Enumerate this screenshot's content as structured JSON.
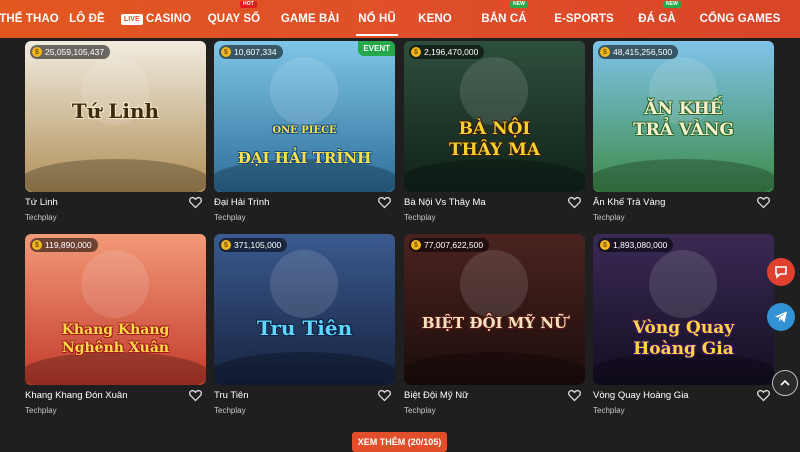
{
  "nav": {
    "items": [
      {
        "label": "THỂ THAO"
      },
      {
        "label": "LÔ ĐỀ"
      },
      {
        "label": "CASINO",
        "live": "LIVE"
      },
      {
        "label": "QUAY SỐ",
        "tag": "HOT"
      },
      {
        "label": "GAME BÀI"
      },
      {
        "label": "NỔ HŨ",
        "active": true
      },
      {
        "label": "KENO"
      },
      {
        "label": "BẮN CÁ",
        "tag": "NEW"
      },
      {
        "label": "E-SPORTS"
      },
      {
        "label": "ĐÁ GÀ",
        "tag": "NEW"
      },
      {
        "label": "CỔNG GAMES"
      }
    ]
  },
  "games": [
    {
      "name": "Tứ Linh",
      "provider": "Techplay",
      "jackpot": "25,059,105,437",
      "art_text": "Tứ Linh",
      "colors": [
        "#f1ebdf",
        "#b09058"
      ]
    },
    {
      "name": "Đại Hải Trình",
      "provider": "Techplay",
      "jackpot": "10,607,334",
      "event": "EVENT",
      "art_text": "ĐẠI HẢI TRÌNH",
      "art_sub": "ONE PIECE",
      "colors": [
        "#7fc6e8",
        "#2e6e98"
      ]
    },
    {
      "name": "Bà Nội Vs Thây Ma",
      "provider": "Techplay",
      "jackpot": "2,196,470,000",
      "art_text": "BÀ NỘI",
      "art_sub": "THÂY MA",
      "colors": [
        "#2e4f3c",
        "#10231a"
      ]
    },
    {
      "name": "Ăn Khế Trả Vàng",
      "provider": "Techplay",
      "jackpot": "48,415,256,500",
      "art_text": "ĂN KHẾ",
      "art_sub": "TRẢ VÀNG",
      "colors": [
        "#7fc3ea",
        "#3f8c4a"
      ]
    },
    {
      "name": "Khang Khang Đón Xuân",
      "provider": "Techplay",
      "jackpot": "119,890,000",
      "art_text": "Khang Khang",
      "art_sub": "Nghênh Xuân",
      "colors": [
        "#f29a78",
        "#c23b2b"
      ]
    },
    {
      "name": "Tru Tiên",
      "provider": "Techplay",
      "jackpot": "371,105,000",
      "art_text": "Tru Tiên",
      "colors": [
        "#3b5a8f",
        "#16233f"
      ]
    },
    {
      "name": "Biệt Đội Mỹ Nữ",
      "provider": "Techplay",
      "jackpot": "77,007,622,500",
      "art_text": "BIỆT ĐỘI MỸ NỮ",
      "colors": [
        "#4a2320",
        "#1c0d0b"
      ]
    },
    {
      "name": "Vòng Quay Hoàng Gia",
      "provider": "Techplay",
      "jackpot": "1,893,080,000",
      "art_text": "Vòng Quay",
      "art_sub": "Hoàng Gia",
      "colors": [
        "#3a2a54",
        "#140e22"
      ]
    }
  ],
  "more_button": {
    "label": "XEM THÊM (20/105)"
  },
  "side": {
    "chat_icon": "chat-icon",
    "telegram_icon": "telegram-icon",
    "up_icon": "chevron-up-icon"
  }
}
